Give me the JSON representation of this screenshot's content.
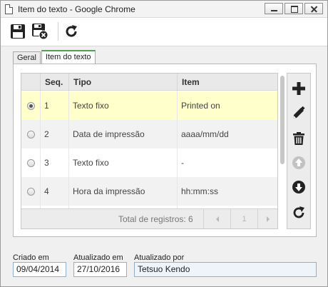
{
  "window": {
    "title": "Item do texto - Google Chrome"
  },
  "toolbar": {
    "save_icon": "floppy-disk-icon",
    "save_close_icon": "floppy-disk-close-icon",
    "refresh_icon": "refresh-icon"
  },
  "tabs": [
    {
      "label": "Geral",
      "active": false
    },
    {
      "label": "Item do texto",
      "active": true
    }
  ],
  "grid": {
    "columns": [
      "",
      "Seq.",
      "Tipo",
      "Item"
    ],
    "rows": [
      {
        "seq": "1",
        "tipo": "Texto fixo",
        "item": "Printed on",
        "selected": true
      },
      {
        "seq": "2",
        "tipo": "Data de impressão",
        "item": "aaaa/mm/dd",
        "selected": false
      },
      {
        "seq": "3",
        "tipo": "Texto fixo",
        "item": "-",
        "selected": false
      },
      {
        "seq": "4",
        "tipo": "Hora da impressão",
        "item": "hh:mm:ss",
        "selected": false
      }
    ],
    "footer": {
      "total": "Total de registros: 6",
      "page": "1"
    }
  },
  "side_actions": [
    {
      "name": "add-icon",
      "enabled": true
    },
    {
      "name": "edit-icon",
      "enabled": true
    },
    {
      "name": "delete-icon",
      "enabled": true
    },
    {
      "name": "move-up-icon",
      "enabled": false
    },
    {
      "name": "move-down-icon",
      "enabled": true
    },
    {
      "name": "refresh-icon",
      "enabled": true
    }
  ],
  "meta": {
    "created_label": "Criado em",
    "created_value": "09/04/2014",
    "updated_label": "Atualizado em",
    "updated_value": "27/10/2016",
    "updated_by_label": "Atualizado por",
    "updated_by_value": "Tetsuo Kendo"
  },
  "colors": {
    "selected_row": "#ffffcc",
    "active_tab_accent": "#4fa14f",
    "icon_dark": "#222222",
    "icon_disabled": "#c2c2c2"
  }
}
